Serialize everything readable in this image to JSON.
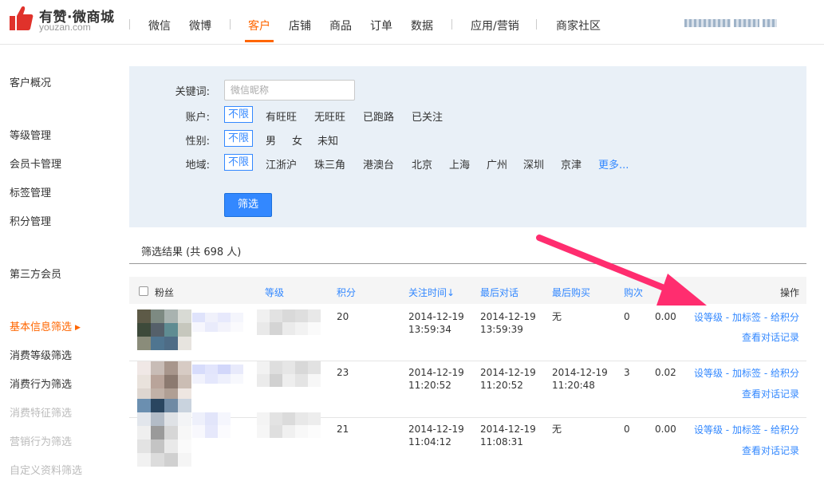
{
  "header": {
    "brand_name": "有赞·微商城",
    "brand_domain": "youzan.com",
    "nav": [
      {
        "label": "微信"
      },
      {
        "label": "微博"
      },
      {
        "label": "客户"
      },
      {
        "label": "店铺"
      },
      {
        "label": "商品"
      },
      {
        "label": "订单"
      },
      {
        "label": "数据"
      },
      {
        "label": "应用/营销"
      },
      {
        "label": "商家社区"
      }
    ],
    "active_nav": "客户",
    "accent_color": "#ff6600"
  },
  "sidebar": {
    "items": [
      {
        "label": "客户概况"
      },
      {
        "label": "等级管理"
      },
      {
        "label": "会员卡管理"
      },
      {
        "label": "标签管理"
      },
      {
        "label": "积分管理"
      },
      {
        "label": "第三方会员"
      },
      {
        "label": "基本信息筛选"
      },
      {
        "label": "消费等级筛选"
      },
      {
        "label": "消费行为筛选"
      },
      {
        "label": "消费特征筛选"
      },
      {
        "label": "营销行为筛选"
      },
      {
        "label": "自定义资料筛选"
      }
    ],
    "active_item": "基本信息筛选",
    "disabled_items": [
      "消费特征筛选",
      "营销行为筛选",
      "自定义资料筛选"
    ]
  },
  "filter": {
    "keyword_label": "关键词:",
    "keyword_placeholder": "微信昵称",
    "account_label": "账户:",
    "account_options": [
      "不限",
      "有旺旺",
      "无旺旺",
      "已跑路",
      "已关注"
    ],
    "gender_label": "性别:",
    "gender_options": [
      "不限",
      "男",
      "女",
      "未知"
    ],
    "region_label": "地域:",
    "region_options": [
      "不限",
      "江浙沪",
      "珠三角",
      "港澳台",
      "北京",
      "上海",
      "广州",
      "深圳",
      "京津"
    ],
    "region_more": "更多...",
    "selected": "不限",
    "submit_label": "筛选",
    "primary_color": "#3388ff"
  },
  "results": {
    "title": "筛选结果 (共 698 人)",
    "columns": [
      "粉丝",
      "等级",
      "积分",
      "关注时间↓",
      "最后对话",
      "最后购买",
      "购次",
      "",
      "操作"
    ],
    "rows": [
      {
        "points": "20",
        "follow_date": "2014-12-19",
        "follow_time": "13:59:34",
        "last_chat_date": "2014-12-19",
        "last_chat_time": "13:59:39",
        "last_purchase_date": "无",
        "last_purchase_time": "",
        "purchases": "0",
        "amount": "0.00"
      },
      {
        "points": "23",
        "follow_date": "2014-12-19",
        "follow_time": "11:20:52",
        "last_chat_date": "2014-12-19",
        "last_chat_time": "11:20:52",
        "last_purchase_date": "2014-12-19",
        "last_purchase_time": "11:20:48",
        "purchases": "3",
        "amount": "0.02"
      },
      {
        "points": "21",
        "follow_date": "2014-12-19",
        "follow_time": "11:04:12",
        "last_chat_date": "2014-12-19",
        "last_chat_time": "11:08:31",
        "last_purchase_date": "无",
        "last_purchase_time": "",
        "purchases": "0",
        "amount": "0.00"
      }
    ],
    "action_set_level": "设等级",
    "action_add_tag": "加标签",
    "action_give_points": "给积分",
    "action_separator": "-",
    "action_view_chat": "查看对话记录"
  },
  "annotation_color": "#ff2d6f"
}
